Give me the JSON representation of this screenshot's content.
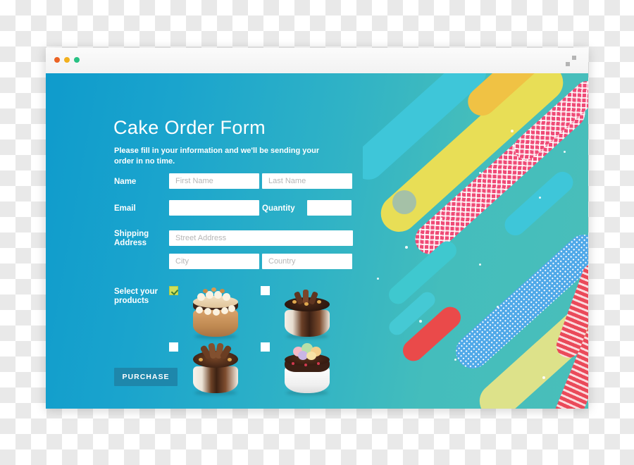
{
  "window": {
    "traffic_lights": [
      {
        "name": "close",
        "color": "#eb6324"
      },
      {
        "name": "minimize",
        "color": "#f2b01e"
      },
      {
        "name": "maximize",
        "color": "#28c183"
      }
    ],
    "expand_icon": "expand-icon"
  },
  "form": {
    "title": "Cake Order Form",
    "subtitle": "Please fill in your information and we'll be sending your order in no time.",
    "labels": {
      "name": "Name",
      "email": "Email",
      "quantity": "Quantity",
      "shipping": "Shipping Address",
      "products": "Select your products"
    },
    "inputs": {
      "first_name": {
        "placeholder": "First Name",
        "value": ""
      },
      "last_name": {
        "placeholder": "Last Name",
        "value": ""
      },
      "email": {
        "placeholder": "",
        "value": ""
      },
      "quantity": {
        "placeholder": "",
        "value": ""
      },
      "street": {
        "placeholder": "Street Address",
        "value": ""
      },
      "city": {
        "placeholder": "City",
        "value": ""
      },
      "country": {
        "placeholder": "Country",
        "value": ""
      }
    },
    "products": [
      {
        "id": "caramel-cream-cake",
        "label": "Caramel Cream Cake",
        "checked": true
      },
      {
        "id": "dark-chocolate-cake",
        "label": "Dark Chocolate Cake",
        "checked": false
      },
      {
        "id": "chocolate-fan-cake",
        "label": "Chocolate Fan Cake",
        "checked": false
      },
      {
        "id": "ice-cream-cake",
        "label": "Ice Cream Cake",
        "checked": false
      }
    ],
    "submit_label": "PURCHASE"
  },
  "theme": {
    "gradient_start": "#0f9bcc",
    "gradient_end": "#49bfba",
    "button_bg": "#1e87ab",
    "checkbox_checked_bg": "#cfe05b",
    "checkbox_check_color": "#3e7d32",
    "accent_yellow": "#e8de56",
    "accent_pink": "#ef4a76",
    "accent_red": "#ea4a4a",
    "accent_cyan": "#3ec6d9",
    "accent_blue": "#4fa8e8",
    "accent_gold": "#f0c244"
  }
}
